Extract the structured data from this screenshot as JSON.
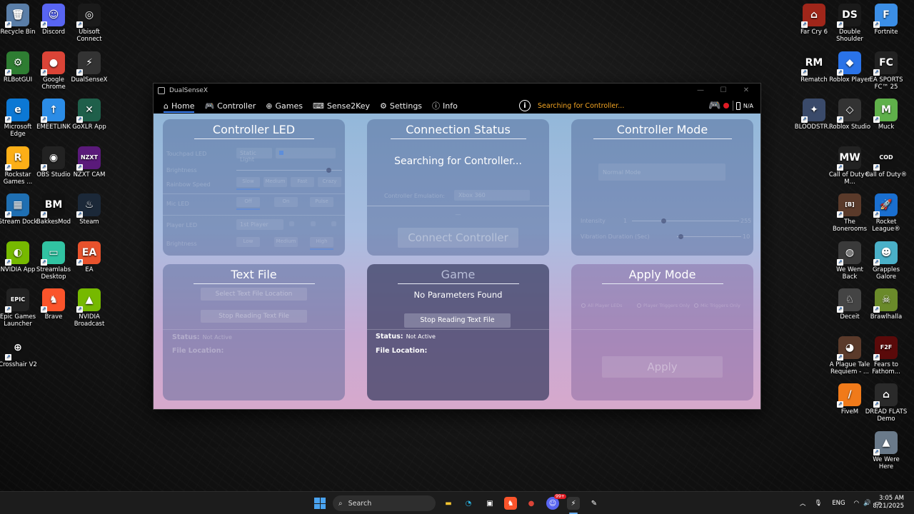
{
  "desktop": {
    "left_icons": [
      {
        "label": "Recycle Bin",
        "glyph": "🗑",
        "color": "#5a7ea8"
      },
      {
        "label": "Discord",
        "glyph": "☺",
        "color": "#5865f2"
      },
      {
        "label": "Ubisoft Connect",
        "glyph": "◎",
        "color": "#1a1a1a"
      },
      {
        "label": "RLBotGUI",
        "glyph": "⚙",
        "color": "#2e7d32"
      },
      {
        "label": "Google Chrome",
        "glyph": "●",
        "color": "#db4437"
      },
      {
        "label": "DualSenseX",
        "glyph": "⚡",
        "color": "#333333"
      },
      {
        "label": "Microsoft Edge",
        "glyph": "e",
        "color": "#0c78d4"
      },
      {
        "label": "EMEETLINK",
        "glyph": "↑",
        "color": "#2b8ce6"
      },
      {
        "label": "GoXLR App",
        "glyph": "✕",
        "color": "#1f5f4a"
      },
      {
        "label": "Rockstar Games ...",
        "glyph": "R",
        "color": "#fcaf17"
      },
      {
        "label": "OBS Studio",
        "glyph": "◉",
        "color": "#222222"
      },
      {
        "label": "NZXT CAM",
        "glyph": "NZXT",
        "color": "#5a1a7a"
      },
      {
        "label": "Stream Dock",
        "glyph": "▦",
        "color": "#1f6fb2"
      },
      {
        "label": "BakkesMod",
        "glyph": "BM",
        "color": "#111111"
      },
      {
        "label": "Steam",
        "glyph": "♨",
        "color": "#1b2838"
      },
      {
        "label": "NVIDIA App",
        "glyph": "◐",
        "color": "#76b900"
      },
      {
        "label": "Streamlabs Desktop",
        "glyph": "▭",
        "color": "#31c3a2"
      },
      {
        "label": "EA",
        "glyph": "EA",
        "color": "#e8522c"
      },
      {
        "label": "Epic Games Launcher",
        "glyph": "EPIC",
        "color": "#222222"
      },
      {
        "label": "Brave",
        "glyph": "♞",
        "color": "#fb542b"
      },
      {
        "label": "NVIDIA Broadcast",
        "glyph": "▲",
        "color": "#76b900"
      },
      {
        "label": "Crosshair V2",
        "glyph": "⊕",
        "color": "#111111"
      }
    ],
    "right_icons": [
      {
        "label": "Far Cry 6",
        "glyph": "⌂",
        "color": "#a0261a"
      },
      {
        "label": "Double Shoulder",
        "glyph": "DS",
        "color": "#1a1a1a"
      },
      {
        "label": "Fortnite",
        "glyph": "F",
        "color": "#3b8ee6"
      },
      {
        "label": "Rematch",
        "glyph": "RM",
        "color": "#111111"
      },
      {
        "label": "Roblox Player",
        "glyph": "◆",
        "color": "#2a73e8"
      },
      {
        "label": "EA SPORTS FC™ 25",
        "glyph": "FC",
        "color": "#222222"
      },
      {
        "label": "BLOODSTR...",
        "glyph": "✦",
        "color": "#3a4a6a"
      },
      {
        "label": "Roblox Studio",
        "glyph": "◇",
        "color": "#333333"
      },
      {
        "label": "Muck",
        "glyph": "M",
        "color": "#5fb04a"
      },
      {
        "label": "Call of Duty® M...",
        "glyph": "MW",
        "color": "#222222"
      },
      {
        "label": "Call of Duty®",
        "glyph": "COD",
        "color": "#111111"
      },
      {
        "label": "The Bonerooms",
        "glyph": "[B]",
        "color": "#5a3a2a"
      },
      {
        "label": "Rocket League®",
        "glyph": "🚀",
        "color": "#1a6fd0"
      },
      {
        "label": "We Went Back",
        "glyph": "◍",
        "color": "#3a3a3a"
      },
      {
        "label": "Grapples Galore",
        "glyph": "☻",
        "color": "#4ab0c8"
      },
      {
        "label": "Deceit",
        "glyph": "♘",
        "color": "#444444"
      },
      {
        "label": "Brawlhalla",
        "glyph": "☠",
        "color": "#6a8a2a"
      },
      {
        "label": "A Plague Tale Requiem - ...",
        "glyph": "◕",
        "color": "#5a3a2a"
      },
      {
        "label": "Fears to Fathom...",
        "glyph": "F2F",
        "color": "#5a0a0a"
      },
      {
        "label": "FiveM",
        "glyph": "/",
        "color": "#f07a1a"
      },
      {
        "label": "DREAD FLATS Demo",
        "glyph": "⌂",
        "color": "#2a2a2a"
      },
      {
        "label": "We Were Here",
        "glyph": "▲",
        "color": "#6a7a8a"
      }
    ]
  },
  "window": {
    "title": "DualSenseX",
    "menu": [
      {
        "label": "Home",
        "icon": "⌂",
        "active": true
      },
      {
        "label": "Controller",
        "icon": "🎮",
        "active": false
      },
      {
        "label": "Games",
        "icon": "⊕",
        "active": false
      },
      {
        "label": "Sense2Key",
        "icon": "⌨",
        "active": false
      },
      {
        "label": "Settings",
        "icon": "⚙",
        "active": false
      },
      {
        "label": "Info",
        "icon": "ⓘ",
        "active": false
      }
    ],
    "status_text": "Searching for Controller...",
    "status_color": "#f5a623",
    "battery_text": "N/A"
  },
  "panels": {
    "controller_led": {
      "title": "Controller LED",
      "rows": [
        "Touchpad LED",
        "Brightness",
        "Rainbow Speed",
        "Mic LED",
        "Player LED",
        "Brightness"
      ],
      "touchpad_select": "Static Light",
      "rainbow_opts": [
        "Slow",
        "Medium",
        "Fast",
        "Crazy"
      ],
      "mic_opts": [
        "Off",
        "On",
        "Pulse"
      ],
      "player_select": "1st Player",
      "brightness_opts": [
        "Low",
        "Medium",
        "High"
      ]
    },
    "connection_status": {
      "title": "Connection Status",
      "message": "Searching for Controller...",
      "emulation_label": "Controller Emulation:",
      "emulation_value": "Xbox 360",
      "divider": "—",
      "connect_button": "Connect Controller"
    },
    "controller_mode": {
      "title": "Controller Mode",
      "select": "Normal Mode",
      "intensity_label": "Intensity",
      "intensity_min": "1",
      "intensity_max": "255",
      "vibration_label": "Vibration Duration (Sec)",
      "vibration_max": "10"
    },
    "text_file": {
      "title": "Text File",
      "select_button": "Select Text File Location",
      "stop_button": "Stop Reading Text File",
      "status_label": "Status:",
      "status_value": "Not Active",
      "location_label": "File Location:"
    },
    "game": {
      "title": "Game",
      "message": "No Parameters Found",
      "stop_button": "Stop Reading Text File",
      "status_label": "Status:",
      "status_value": "Not Active",
      "location_label": "File Location:"
    },
    "apply_mode": {
      "title": "Apply Mode",
      "options": [
        "All Player LEDs",
        "Player Triggers Only",
        "Mic Triggers Only"
      ],
      "apply_button": "Apply"
    }
  },
  "taskbar": {
    "search_placeholder": "Search",
    "apps": [
      "file-explorer",
      "edge",
      "store",
      "brave",
      "chrome",
      "discord",
      "dualsensex",
      "notepad"
    ],
    "discord_badge": "99+",
    "language": "ENG",
    "time": "3:05 AM",
    "date": "8/21/2025"
  }
}
